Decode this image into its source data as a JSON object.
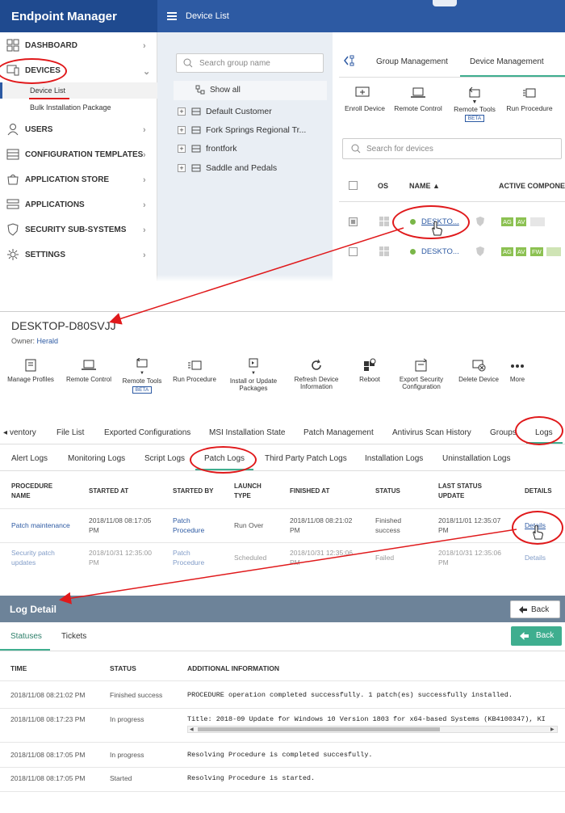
{
  "app": {
    "title": "Endpoint Manager",
    "page_title": "Device List"
  },
  "sidebar": {
    "items": [
      {
        "label": "DASHBOARD",
        "icon": "dashboard-icon"
      },
      {
        "label": "DEVICES",
        "icon": "devices-icon"
      },
      {
        "label": "USERS",
        "icon": "users-icon"
      },
      {
        "label": "CONFIGURATION TEMPLATES",
        "icon": "templates-icon"
      },
      {
        "label": "APPLICATION STORE",
        "icon": "store-icon"
      },
      {
        "label": "APPLICATIONS",
        "icon": "applications-icon"
      },
      {
        "label": "SECURITY SUB-SYSTEMS",
        "icon": "shield-icon"
      },
      {
        "label": "SETTINGS",
        "icon": "gear-icon"
      }
    ],
    "sub_items": [
      "Device List",
      "Bulk Installation Package"
    ]
  },
  "groups": {
    "search_placeholder": "Search group name",
    "show_all": "Show all",
    "list": [
      "Default Customer",
      "Fork Springs Regional Tr...",
      "frontfork",
      "Saddle and Pedals"
    ]
  },
  "device_panel": {
    "tabs": [
      "Group Management",
      "Device Management"
    ],
    "actions": [
      {
        "label": "Enroll Device"
      },
      {
        "label": "Remote Control"
      },
      {
        "label": "Remote Tools",
        "badge": "BETA"
      },
      {
        "label": "Run Procedure"
      }
    ],
    "search_placeholder": "Search for devices",
    "columns": [
      "OS",
      "NAME ▲",
      "ACTIVE COMPONENTS"
    ],
    "rows": [
      {
        "name": "DESKTO...",
        "components": [
          "AG",
          "AV"
        ]
      },
      {
        "name": "DESKTO...",
        "components": [
          "AG",
          "AV",
          "FW"
        ]
      }
    ]
  },
  "device_detail": {
    "name": "DESKTOP-D80SVJJ",
    "owner_label": "Owner:",
    "owner": "Herald",
    "toolbar": [
      {
        "label": "Manage Profiles"
      },
      {
        "label": "Remote Control"
      },
      {
        "label": "Remote Tools",
        "badge": "BETA"
      },
      {
        "label": "Run Procedure"
      },
      {
        "label": "Install or Update Packages"
      },
      {
        "label": "Refresh Device Information"
      },
      {
        "label": "Reboot"
      },
      {
        "label": "Export Security Configuration"
      },
      {
        "label": "Delete Device"
      },
      {
        "label": "More"
      }
    ],
    "tabs": [
      "ventory",
      "File List",
      "Exported Configurations",
      "MSI Installation State",
      "Patch Management",
      "Antivirus Scan History",
      "Groups",
      "Logs"
    ],
    "log_tabs": [
      "Alert Logs",
      "Monitoring Logs",
      "Script Logs",
      "Patch Logs",
      "Third Party Patch Logs",
      "Installation Logs",
      "Uninstallation Logs"
    ],
    "columns": [
      "PROCEDURE NAME",
      "STARTED AT",
      "STARTED BY",
      "LAUNCH TYPE",
      "FINISHED AT",
      "STATUS",
      "LAST STATUS UPDATE",
      "DETAILS"
    ],
    "rows": [
      {
        "procedure": "Patch maintenance",
        "started_at": "2018/11/08 08:17:05 PM",
        "started_by": "Patch Procedure",
        "launch": "Run Over",
        "finished_at": "2018/11/08 08:21:02 PM",
        "status": "Finished success",
        "last_update": "2018/11/01 12:35:07 PM",
        "details": "Details"
      },
      {
        "procedure": "Security patch updates",
        "started_at": "2018/10/31 12:35:00 PM",
        "started_by": "Patch Procedure",
        "launch": "Scheduled",
        "finished_at": "2018/10/31 12:35:06 PM",
        "status": "Failed",
        "last_update": "2018/10/31 12:35:06 PM",
        "details": "Details"
      }
    ]
  },
  "log_detail": {
    "title": "Log Detail",
    "back": "Back",
    "tabs": [
      "Statuses",
      "Tickets"
    ],
    "columns": [
      "TIME",
      "STATUS",
      "ADDITIONAL INFORMATION"
    ],
    "rows": [
      {
        "time": "2018/11/08 08:21:02 PM",
        "status": "Finished success",
        "info": "PROCEDURE operation completed successfully. 1 patch(es) successfully installed."
      },
      {
        "time": "2018/11/08 08:17:23 PM",
        "status": "In progress",
        "info": "Title: 2018-09 Update for Windows 10 Version 1803 for x64-based Systems (KB4100347), KI"
      },
      {
        "time": "2018/11/08 08:17:05 PM",
        "status": "In progress",
        "info": "Resolving Procedure is completed succesfully."
      },
      {
        "time": "2018/11/08 08:17:05 PM",
        "status": "Started",
        "info": "Resolving Procedure is started."
      }
    ]
  },
  "colors": {
    "brand": "#2d5aa3",
    "accent_green": "#3fae8f",
    "highlight_red": "#e0191b",
    "online": "#7ab648"
  }
}
